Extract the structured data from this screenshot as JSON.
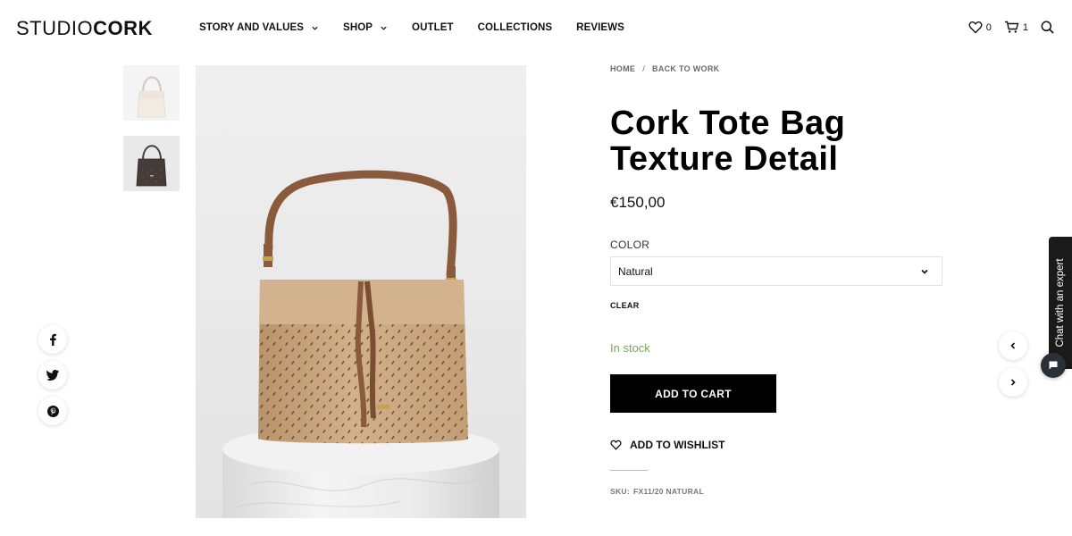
{
  "brand": {
    "light": "STUDIO",
    "bold": "CORK"
  },
  "nav": {
    "items": [
      {
        "label": "STORY AND VALUES",
        "has_dropdown": true
      },
      {
        "label": "SHOP",
        "has_dropdown": true
      },
      {
        "label": "OUTLET",
        "has_dropdown": false
      },
      {
        "label": "COLLECTIONS",
        "has_dropdown": false
      },
      {
        "label": "REVIEWS",
        "has_dropdown": false
      }
    ]
  },
  "header_icons": {
    "wishlist_count": "0",
    "cart_count": "1",
    "icons": [
      "heart-icon",
      "cart-icon",
      "search-icon"
    ]
  },
  "gallery": {
    "thumbnails": [
      "natural cork bag",
      "dark cork bag"
    ],
    "main_image": "cork tote bag on marble pedestal"
  },
  "social": [
    "facebook-icon",
    "twitter-icon",
    "pinterest-icon"
  ],
  "breadcrumb": {
    "home": "HOME",
    "separator": "/",
    "back": "BACK TO WORK"
  },
  "product": {
    "title_line1": "Cork Tote Bag",
    "title_line2": "Texture Detail",
    "price": "€150,00",
    "color_label": "COLOR",
    "color_value": "Natural",
    "clear_label": "CLEAR",
    "stock": "In stock",
    "add_to_cart": "ADD TO CART",
    "add_to_wishlist": "ADD TO WISHLIST",
    "sku_label": "SKU:",
    "sku_value": "FX11/20 NATURAL"
  },
  "chat": {
    "label": "Chat with an expert"
  },
  "colors": {
    "accent": "#000000",
    "stock_green": "#7da55a",
    "chat_bg": "#1a1a1a",
    "image_bg": "#ececec",
    "cork": "#c9a57c",
    "strap": "#8a5a3c"
  }
}
